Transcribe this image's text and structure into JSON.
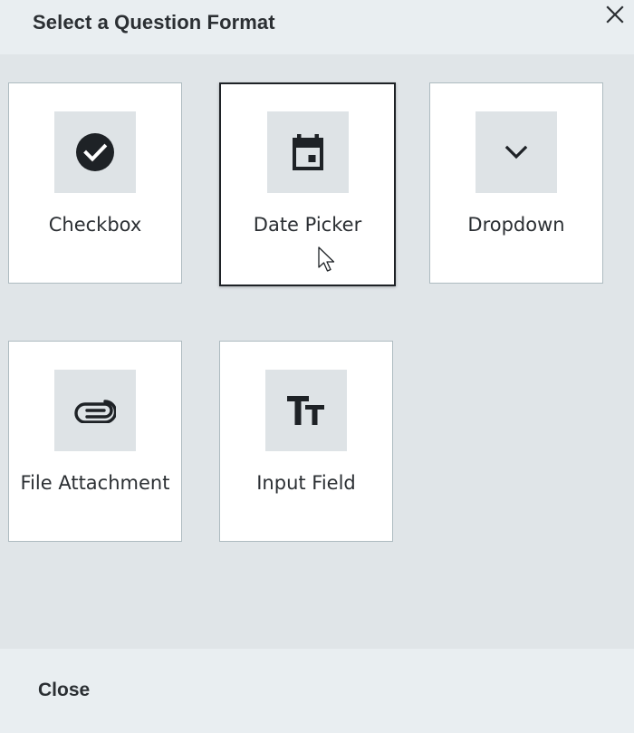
{
  "dialog": {
    "title": "Select a Question Format",
    "footer_close_label": "Close"
  },
  "formats": [
    {
      "label": "Checkbox",
      "icon": "check-circle-icon",
      "selected": false
    },
    {
      "label": "Date Picker",
      "icon": "calendar-icon",
      "selected": true
    },
    {
      "label": "Dropdown",
      "icon": "chevron-down-icon",
      "selected": false
    },
    {
      "label": "File Attachment",
      "icon": "paperclip-icon",
      "selected": false
    },
    {
      "label": "Input Field",
      "icon": "text-size-icon",
      "selected": false
    }
  ],
  "colors": {
    "header_bg": "#e9eef1",
    "body_bg": "#e0e5e8",
    "card_border": "#aebbc0",
    "selected_border": "#1e2226",
    "icon_tile_bg": "#dee3e6",
    "text": "#2b2f33"
  }
}
